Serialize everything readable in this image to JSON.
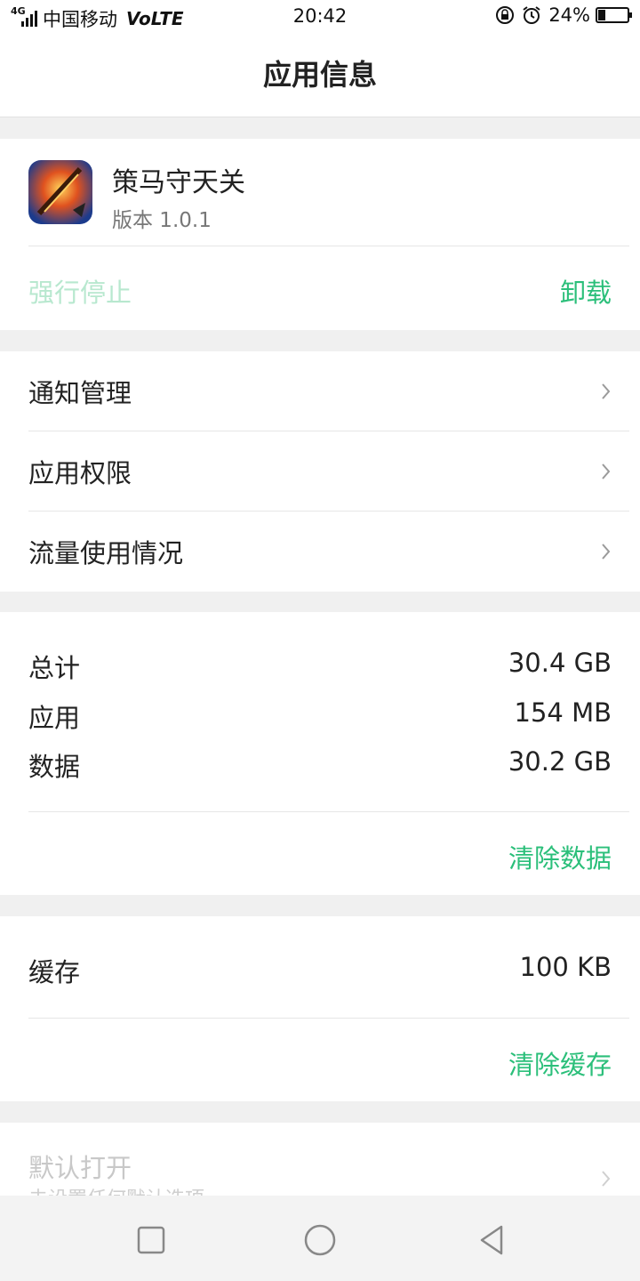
{
  "status_bar": {
    "network": "4G",
    "carrier": "中国移动",
    "volte": "VoLTE",
    "time": "20:42",
    "battery_percent": "24%",
    "battery_level": 0.24,
    "icons": [
      "signal-icon",
      "rotation-lock-icon",
      "alarm-icon",
      "battery-icon"
    ]
  },
  "header": {
    "title": "应用信息"
  },
  "app": {
    "name": "策马守天关",
    "version": "版本 1.0.1",
    "force_stop_label": "强行停止",
    "uninstall_label": "卸载"
  },
  "menu": {
    "items": [
      {
        "label": "通知管理"
      },
      {
        "label": "应用权限"
      },
      {
        "label": "流量使用情况"
      }
    ]
  },
  "storage": {
    "rows": [
      {
        "key": "总计",
        "value": "30.4 GB"
      },
      {
        "key": "应用",
        "value": "154 MB"
      },
      {
        "key": "数据",
        "value": "30.2 GB"
      }
    ],
    "clear_data_label": "清除数据"
  },
  "cache": {
    "key": "缓存",
    "value": "100 KB",
    "clear_cache_label": "清除缓存"
  },
  "default_open": {
    "title": "默认打开",
    "subtitle": "未设置任何默认选项"
  },
  "colors": {
    "accent": "#2bbf7a",
    "accent_disabled": "#b8e8cf",
    "background": "#f0f0f0"
  }
}
